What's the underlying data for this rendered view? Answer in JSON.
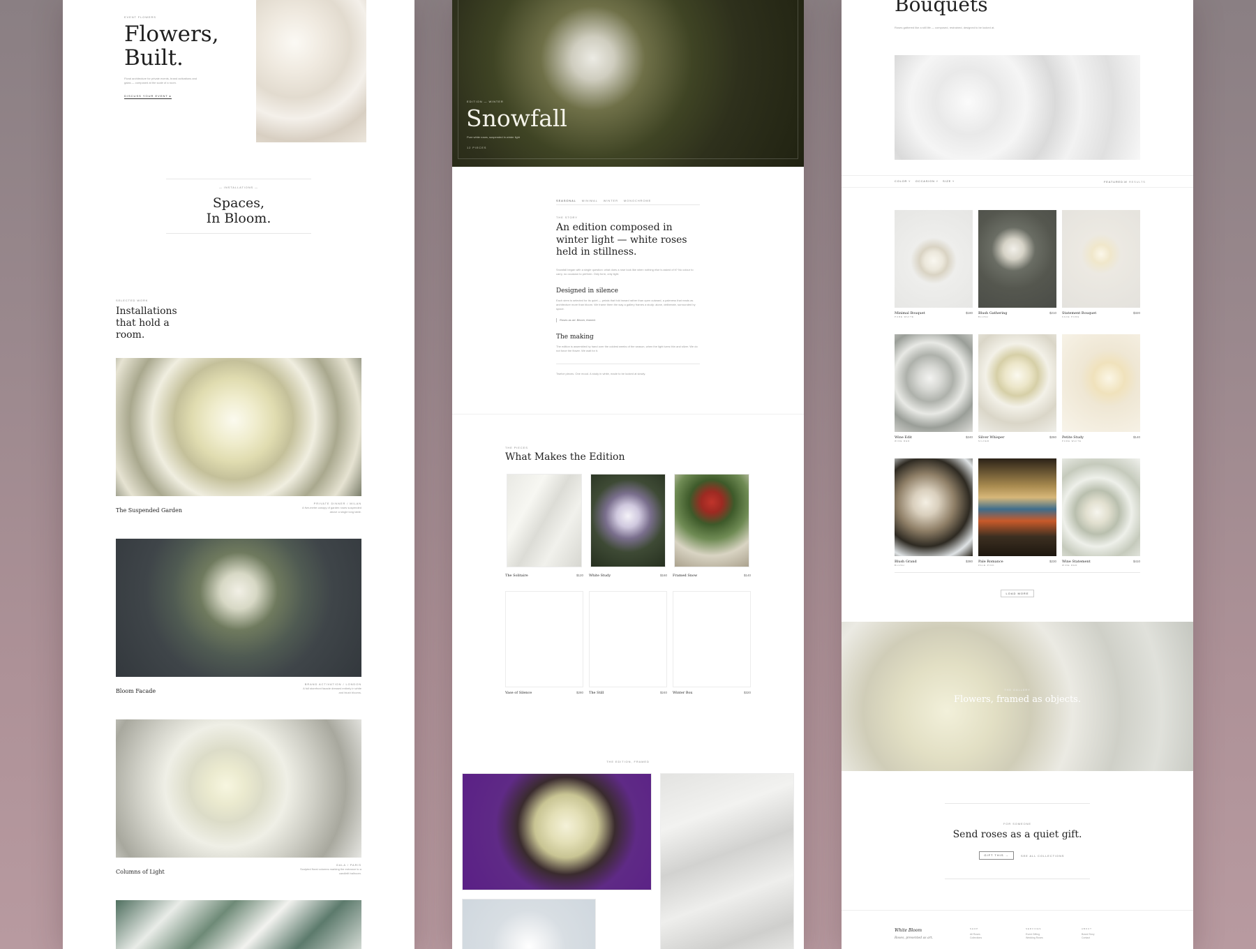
{
  "installations_page": {
    "eyebrow": "EVENT FLOWERS",
    "hero_line1": "Flowers,",
    "hero_line2": "Built.",
    "hero_body": "Floral architecture for private events, brand activations and galas — composed at the scale of a room.",
    "hero_cta": "DISCUSS YOUR EVENT",
    "hero_cta_icon": "arrow-right-icon",
    "section_eyebrow": "— INSTALLATIONS —",
    "section_title_line1": "Spaces,",
    "section_title_line2": "In Bloom.",
    "works_eyebrow": "SELECTED WORK",
    "works_title_line1": "Installations",
    "works_title_line2": "that hold a",
    "works_title_line3": "room.",
    "works": [
      {
        "title": "The Suspended Garden",
        "meta": "PRIVATE DINNER / MILAN",
        "desc": "A five-metre canopy of garden roses suspended above a single long table."
      },
      {
        "title": "Bloom Facade",
        "meta": "BRAND ACTIVATION / LONDON",
        "desc": "A full storefront facade dressed entirely in white and blush blooms."
      },
      {
        "title": "Columns of Light",
        "meta": "GALA / PARIS",
        "desc": "Sculpted floral columns marking the entrance to a candlelit ballroom."
      }
    ]
  },
  "edition_page": {
    "hero_eyebrow": "EDITION — WINTER",
    "hero_title": "Snowfall",
    "hero_sub": "Pure white roses, suspended in winter light",
    "hero_count": "12 PIECES",
    "tags": [
      "SEASONAL",
      "MINIMAL",
      "WINTER",
      "MONOCHROME"
    ],
    "story_eyebrow": "THE STORY",
    "story_title": "An edition composed in winter light — white roses held in stillness.",
    "story_body": "Snowfall began with a single question: what does a rose look like when nothing else is asked of it? No colour to carry, no occasion to perform. Only form, only light.",
    "designed_title": "Designed in silence",
    "designed_body": "Each stem is selected for its quiet — petals that fold inward rather than open outward, a paleness that reads as architecture more than bloom. We frame them the way a gallery frames a study: alone, deliberate, surrounded by space.",
    "quote": "Roses as art. Bloom, framed.",
    "making_title": "The making",
    "making_body": "The edition is assembled by hand over the coldest weeks of the season, when the light turns thin and silver. We do not force the flower. We wait for it.",
    "closing": "Twelve pieces. One mood. A study in white, made to be looked at slowly.",
    "pieces_eyebrow": "THE PIECES",
    "pieces_title": "What Makes the Edition",
    "pieces": [
      {
        "name": "The Solitaire",
        "price": "$120"
      },
      {
        "name": "White Study",
        "price": "$160"
      },
      {
        "name": "Framed Snow",
        "price": "$140"
      },
      {
        "name": "Vase of Silence",
        "price": "$280"
      },
      {
        "name": "The Still",
        "price": "$240"
      },
      {
        "name": "Winter Box",
        "price": "$320"
      }
    ],
    "gallery_eyebrow": "THE EDITION, FRAMED"
  },
  "bouquets_page": {
    "title": "Bouquets",
    "subtitle": "Roses gathered like a still life — composed, restrained, designed to be looked at.",
    "filters": [
      "COLOR",
      "OCCASION",
      "SIZE"
    ],
    "sort": "FEATURED",
    "results": "12 RESULTS",
    "products": [
      {
        "name": "Minimal Bouquet",
        "price": "$180",
        "sub": "PURE WHITE"
      },
      {
        "name": "Blush Gathering",
        "price": "$210",
        "sub": "BLUSH"
      },
      {
        "name": "Statement Bouquet",
        "price": "$320",
        "sub": "FACE PURE"
      },
      {
        "name": "Wine Edit",
        "price": "$240",
        "sub": "WINE RED"
      },
      {
        "name": "Silver Whisper",
        "price": "$260",
        "sub": "SILVER"
      },
      {
        "name": "Petite Study",
        "price": "$140",
        "sub": "PURE WHITE"
      },
      {
        "name": "Blush Grand",
        "price": "$380",
        "sub": "BLUSH"
      },
      {
        "name": "Pale Romance",
        "price": "$230",
        "sub": "PALE PINK"
      },
      {
        "name": "Wine Statement",
        "price": "$410",
        "sub": "WINE RED"
      }
    ],
    "load_more": "LOAD MORE",
    "banner_eyebrow": "THE GALLERY",
    "banner_title": "Flowers, framed as objects.",
    "gift_eyebrow": "FOR SOMEONE",
    "gift_title": "Send roses as a quiet gift.",
    "gift_cta": "GIFT THIS",
    "gift_link": "SEE ALL COLLECTIONS",
    "footer_brand": "White Bloom",
    "footer_tagline": "Roses, presented as art.",
    "footer_cols": [
      {
        "head": "SHOP",
        "links": [
          "All Roses",
          "Collections"
        ]
      },
      {
        "head": "SERVICES",
        "links": [
          "Event Gifting",
          "Wedding Roses"
        ]
      },
      {
        "head": "ABOUT",
        "links": [
          "Brand Story",
          "Contact"
        ]
      }
    ]
  }
}
